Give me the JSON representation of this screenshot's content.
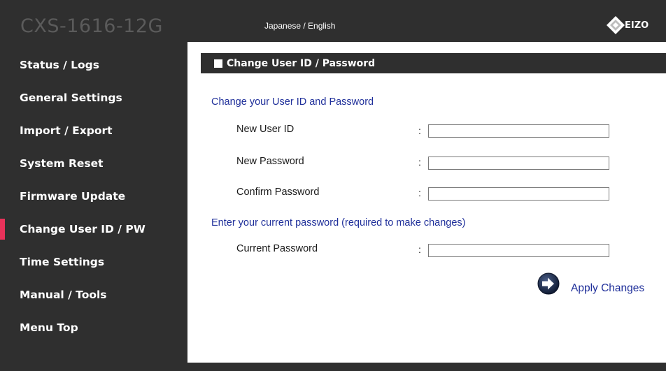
{
  "header": {
    "model": "CXS-1616-12G",
    "language_toggle": "Japanese / English",
    "logo_text": "EIZO"
  },
  "sidebar": {
    "items": [
      {
        "label": "Status / Logs",
        "active": false
      },
      {
        "label": "General Settings",
        "active": false
      },
      {
        "label": "Import / Export",
        "active": false
      },
      {
        "label": "System Reset",
        "active": false
      },
      {
        "label": "Firmware Update",
        "active": false
      },
      {
        "label": "Change User ID / PW",
        "active": true
      },
      {
        "label": "Time Settings",
        "active": false
      },
      {
        "label": "Manual / Tools",
        "active": false
      },
      {
        "label": "Menu Top",
        "active": false
      }
    ],
    "accent_color": "#e8325a"
  },
  "main": {
    "title": "Change User ID / Password",
    "section1_heading": "Change your User ID and Password",
    "section2_heading": "Enter your current password (required to make changes)",
    "separator": ":",
    "fields": {
      "new_user_id": {
        "label": "New User ID",
        "value": ""
      },
      "new_password": {
        "label": "New Password",
        "value": ""
      },
      "confirm_password": {
        "label": "Confirm Password",
        "value": ""
      },
      "current_password": {
        "label": "Current Password",
        "value": ""
      }
    },
    "apply_label": "Apply Changes"
  },
  "colors": {
    "background": "#2f2f2f",
    "link_blue": "#1f2f9a",
    "content_bg": "#ffffff"
  }
}
